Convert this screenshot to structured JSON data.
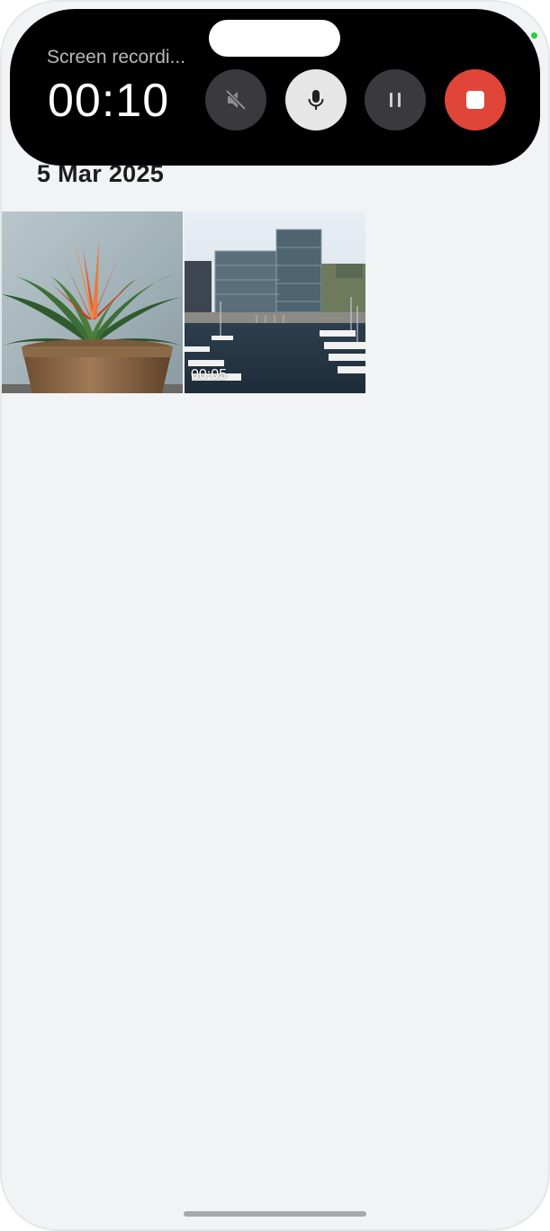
{
  "recording": {
    "title": "Screen recordi...",
    "elapsed": "00:10",
    "controls": {
      "mute": "speaker-muted-icon",
      "mic": "microphone-icon",
      "pause": "pause-icon",
      "stop": "stop-icon"
    }
  },
  "gallery": {
    "date_header": "5 Mar 2025",
    "items": [
      {
        "type": "photo",
        "subject": "potted bromeliad plant"
      },
      {
        "type": "video",
        "subject": "harbor with glass office buildings",
        "duration": "00:05"
      }
    ]
  },
  "colors": {
    "stop_button": "#e0453a",
    "recording_bar": "#000000",
    "background": "#f2f3f5"
  }
}
